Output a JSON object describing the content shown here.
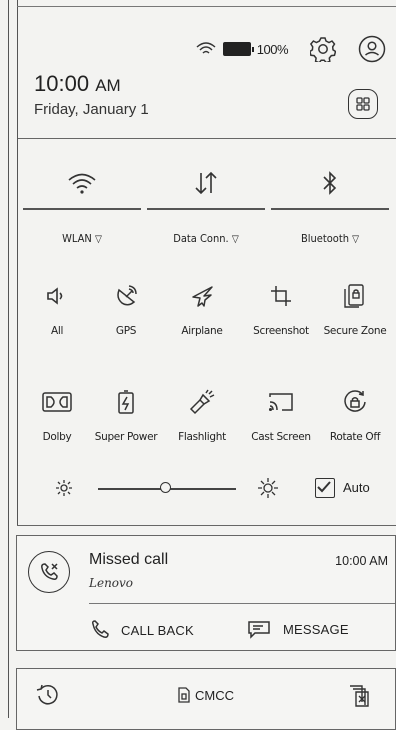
{
  "status": {
    "battery_text": "100%"
  },
  "clock": {
    "time": "10:00",
    "ampm": "AM",
    "date": "Friday, January 1"
  },
  "toggles": [
    {
      "label": "WLAN",
      "icon": "wifi-icon"
    },
    {
      "label": "Data Conn.",
      "icon": "data-arrows-icon"
    },
    {
      "label": "Bluetooth",
      "icon": "bluetooth-icon"
    }
  ],
  "tiles_row1": [
    {
      "label": "All",
      "icon": "volume-icon"
    },
    {
      "label": "GPS",
      "icon": "gps-satellite-icon"
    },
    {
      "label": "Airplane",
      "icon": "airplane-icon"
    },
    {
      "label": "Screenshot",
      "icon": "screenshot-crop-icon"
    },
    {
      "label": "Secure Zone",
      "icon": "secure-zone-icon"
    }
  ],
  "tiles_row2": [
    {
      "label": "Dolby",
      "icon": "dolby-icon"
    },
    {
      "label": "Super Power",
      "icon": "battery-bolt-icon"
    },
    {
      "label": "Flashlight",
      "icon": "flashlight-icon"
    },
    {
      "label": "Cast Screen",
      "icon": "cast-screen-icon"
    },
    {
      "label": "Rotate Off",
      "icon": "rotate-lock-icon"
    }
  ],
  "brightness": {
    "auto_label": "Auto",
    "auto_checked": true
  },
  "notification": {
    "title": "Missed call",
    "subtitle": "Lenovo",
    "time": "10:00 AM",
    "call_back_label": "CALL BACK",
    "message_label": "MESSAGE"
  },
  "bottom": {
    "carrier": "CMCC"
  }
}
